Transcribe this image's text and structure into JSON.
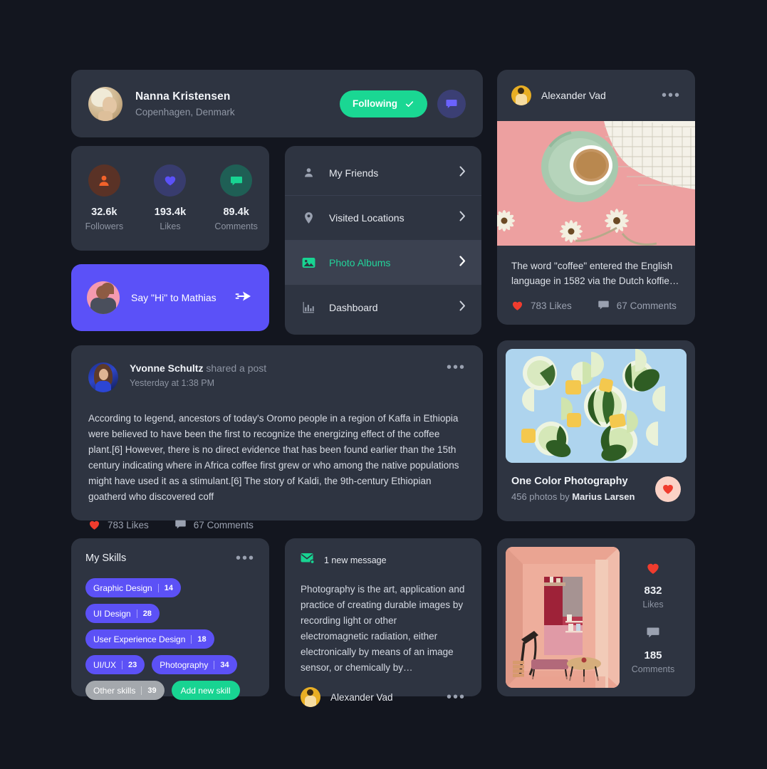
{
  "profile": {
    "name": "Nanna Kristensen",
    "location": "Copenhagen, Denmark",
    "following_label": "Following",
    "avatar_name": "nanna-avatar",
    "accent_green": "#1ad793",
    "message_button_bg": "#3b3f74"
  },
  "stats": [
    {
      "icon": "person-icon",
      "value": "32.6k",
      "label": "Followers",
      "circle_bg": "#5a3226",
      "icon_color": "#f2622a"
    },
    {
      "icon": "heart-icon",
      "value": "193.4k",
      "label": "Likes",
      "circle_bg": "#383c6e",
      "icon_color": "#5b51f8"
    },
    {
      "icon": "comment-icon",
      "value": "89.4k",
      "label": "Comments",
      "circle_bg": "#1f5f55",
      "icon_color": "#18d492"
    }
  ],
  "sayhi": {
    "label": "Say \"Hi\" to Mathias",
    "icon": "send-icon",
    "bg": "#5b51f8"
  },
  "menu": [
    {
      "icon": "person-icon",
      "label": "My Friends",
      "active": false
    },
    {
      "icon": "location-pin-icon",
      "label": "Visited Locations",
      "active": false
    },
    {
      "icon": "photo-icon",
      "label": "Photo Albums",
      "active": true
    },
    {
      "icon": "bar-chart-icon",
      "label": "Dashboard",
      "active": false
    }
  ],
  "post": {
    "author": "Yvonne Schultz",
    "action": "shared a post",
    "time": "Yesterday at 1:38 PM",
    "body": "According to legend, ancestors of today's Oromo people in a region of Kaffa in Ethiopia were believed to have been the first to recognize the energizing effect of the coffee plant.[6] However, there is no direct evidence that has been found earlier than the 15th century indicating where in Africa coffee first grew or who among the native populations might have used it as a stimulant.[6] The story of Kaldi, the 9th-century Ethiopian goatherd who discovered coff",
    "likes": "783 Likes",
    "comments": "67 Comments",
    "menu_icon": "more-options-icon"
  },
  "skills": {
    "title": "My Skills",
    "menu_icon": "more-options-icon",
    "tags": [
      {
        "label": "Graphic Design",
        "count": "14",
        "muted": false
      },
      {
        "label": "UI Design",
        "count": "28",
        "muted": false
      },
      {
        "label": "User Experience Design",
        "count": "18",
        "muted": false
      },
      {
        "label": "UI/UX",
        "count": "23",
        "muted": false
      },
      {
        "label": "Photography",
        "count": "34",
        "muted": false
      },
      {
        "label": "Other skills",
        "count": "39",
        "muted": true
      }
    ],
    "add_label": "Add new skill",
    "tag_color": "#5c51f6",
    "add_color": "#18d492"
  },
  "message": {
    "icon": "envelope-icon",
    "count_label": "1 new message",
    "body": "Photography is the art, application and practice of creating durable images by recording light or other electromagnetic radiation, either electronically by means of an image sensor, or chemically by…",
    "author": "Alexander Vad",
    "menu_icon": "more-options-icon"
  },
  "coffee_post": {
    "author": "Alexander Vad",
    "menu_icon": "more-options-icon",
    "photo_name": "coffee-cup-photo",
    "caption": "The word \"coffee\" entered the English language in 1582 via the Dutch koffie…",
    "likes": "783 Likes",
    "comments": "67 Comments"
  },
  "album": {
    "photo_name": "lime-mint-photo",
    "title": "One Color Photography",
    "sub_prefix": "456 photos by ",
    "sub_author": "Marius Larsen",
    "like_icon": "heart-icon",
    "like_bg": "#fbd2c6"
  },
  "room": {
    "photo_name": "pink-room-photo",
    "stats": [
      {
        "icon": "heart-icon",
        "value": "832",
        "label": "Likes"
      },
      {
        "icon": "comment-icon",
        "value": "185",
        "label": "Comments"
      }
    ]
  }
}
